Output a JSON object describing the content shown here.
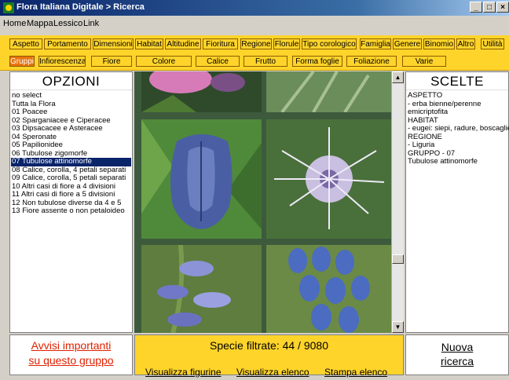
{
  "window": {
    "title": "Flora Italiana Digitale > Ricerca",
    "buttons": [
      "_",
      "□",
      "×"
    ]
  },
  "menu": [
    "Home",
    "Mappa",
    "Lessico",
    "Link"
  ],
  "toolbar1": [
    "Aspetto",
    "Portamento",
    "Dimensioni",
    "Habitat",
    "Altitudine",
    "Fioritura",
    "Regione",
    "Florule",
    "Tipo corologico",
    "Famiglia",
    "Genere",
    "Binomio",
    "Altro",
    "Utilità"
  ],
  "toolbar2": {
    "items": [
      "Gruppi",
      "Infiorescenza",
      "Fiore",
      "Colore",
      "Calice",
      "Frutto",
      "Forma foglie",
      "Foliazione",
      "Varie"
    ],
    "active_index": 0
  },
  "options": {
    "title": "OPZIONI",
    "items": [
      "no select",
      "Tutta la Flora",
      "01 Poacee",
      "02 Sparganiacee e Ciperacee",
      "03 Dipsacacee e Asteracee",
      "04 Speronate",
      "05 Papilionidee",
      "06 Tubulose zigomorfe",
      "07 Tubulose attinomorfe",
      "08 Calice, corolla, 4 petali separati",
      "09 Calice, corolla, 5 petali separati",
      "10 Altri casi di fiore a 4 divisioni",
      "11 Altri casi di fiore a 5 divisioni",
      "12 Non tubulose diverse da 4 e 5",
      "13 Fiore assente o non petaloideo"
    ],
    "selected_index": 8
  },
  "choices": {
    "title": "SCELTE",
    "lines": [
      "ASPETTO",
      "- erba bienne/perenne",
      "emicriptofita",
      "HABITAT",
      "- eugei: siepi, radure, boscaglie",
      "REGIONE",
      "- Liguria",
      "GRUPPO - 07",
      "Tubulose attinomorfe"
    ]
  },
  "bottom": {
    "left": [
      "Avvisi importanti",
      "su questo gruppo"
    ],
    "species_label": "Specie filtrate: 44 / 9080",
    "links": [
      "Visualizza figurine",
      "Visualizza elenco",
      "Stampa elenco"
    ],
    "right": [
      "Nuova",
      "ricerca"
    ]
  },
  "colors": {
    "toolbar": "#ffd42a",
    "active_tab": "#e8740c",
    "selection": "#0a246a",
    "warning_link": "#e02000"
  }
}
